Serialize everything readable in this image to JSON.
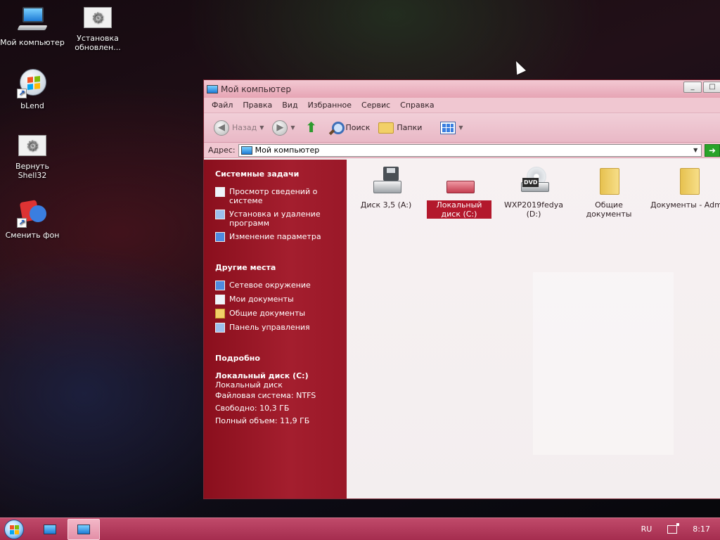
{
  "desktop": {
    "icons": [
      {
        "label": "Мой компьютер"
      },
      {
        "label": "Установка обновлен..."
      },
      {
        "label": "bLend"
      },
      {
        "label": "Вернуть Shell32"
      },
      {
        "label": "Сменить фон"
      }
    ]
  },
  "window": {
    "title": "Мой компьютер",
    "controls": {
      "minimize": "_",
      "maximize": "□"
    },
    "menu": [
      "Файл",
      "Правка",
      "Вид",
      "Избранное",
      "Сервис",
      "Справка"
    ],
    "toolbar": {
      "back_label": "Назад",
      "search_label": "Поиск",
      "folders_label": "Папки"
    },
    "address": {
      "label": "Адрес:",
      "value": "Мой компьютер",
      "go": "➜"
    },
    "left_pane": {
      "system_tasks": {
        "header": "Системные задачи",
        "items": [
          "Просмотр сведений о системе",
          "Установка и удаление программ",
          "Изменение параметра"
        ]
      },
      "other_places": {
        "header": "Другие места",
        "items": [
          "Сетевое окружение",
          "Мои документы",
          "Общие документы",
          "Панель управления"
        ]
      },
      "details": {
        "header": "Подробно",
        "name": "Локальный диск (C:)",
        "type": "Локальный диск",
        "filesystem": "Файловая система: NTFS",
        "free": "Свободно: 10,3 ГБ",
        "total": "Полный объем: 11,9 ГБ"
      }
    },
    "items": [
      {
        "label": "Диск 3,5 (A:)",
        "icon": "floppy-drive-icon"
      },
      {
        "label": "Локальный диск (C:)",
        "icon": "hard-drive-icon",
        "selected": true
      },
      {
        "label": "WXP2019fedya (D:)",
        "icon": "dvd-drive-icon",
        "badge": "DVD"
      },
      {
        "label": "Общие документы",
        "icon": "folder-icon"
      },
      {
        "label": "Документы - Admin",
        "icon": "folder-icon"
      }
    ]
  },
  "taskbar": {
    "language": "RU",
    "clock": "8:17"
  },
  "colors": {
    "accent": "#a41e2e",
    "taskbar": "#b63b5e",
    "selection": "#b3182c"
  }
}
